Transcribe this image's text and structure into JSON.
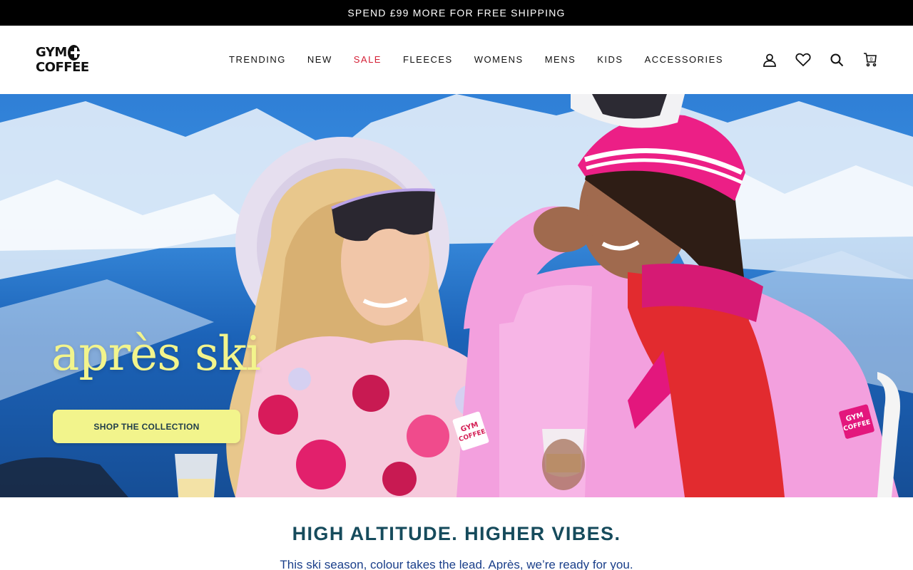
{
  "announcement": {
    "text": "SPEND £99 MORE FOR FREE SHIPPING"
  },
  "brand": {
    "line1": "GYM",
    "line2": "COFFEE"
  },
  "nav": {
    "items": [
      {
        "label": "TRENDING"
      },
      {
        "label": "NEW"
      },
      {
        "label": "SALE"
      },
      {
        "label": "FLEECES"
      },
      {
        "label": "WOMENS"
      },
      {
        "label": "MENS"
      },
      {
        "label": "KIDS"
      },
      {
        "label": "ACCESSORIES"
      }
    ]
  },
  "header_icons": [
    "account-icon",
    "wishlist-heart-icon",
    "search-icon",
    "cart-icon"
  ],
  "cart": {
    "count": "0"
  },
  "hero": {
    "title": "après ski",
    "cta_label": "SHOP THE COLLECTION",
    "image_text": "GYM COFFEE"
  },
  "section": {
    "headline": "HIGH ALTITUDE. HIGHER VIBES.",
    "subline": "This ski season, colour takes the lead. Après, we’re ready for you."
  },
  "colors": {
    "announcement_bg": "#000000",
    "sale": "#d41f35",
    "hero_accent": "#f2f48c",
    "headline": "#164b5c",
    "subline": "#1a3f8a"
  }
}
